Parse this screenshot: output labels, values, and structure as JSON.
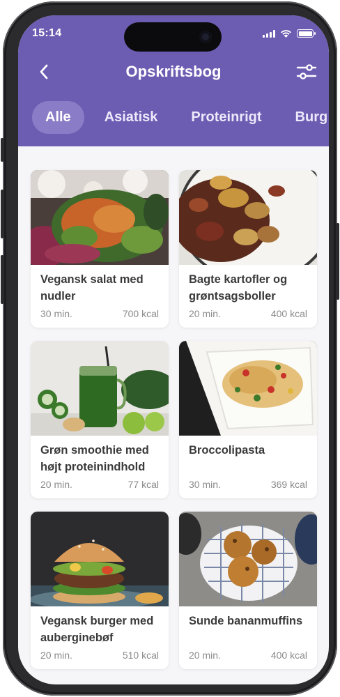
{
  "status_bar": {
    "time": "15:14"
  },
  "header": {
    "title": "Opskriftsbog"
  },
  "tabs": [
    {
      "label": "Alle"
    },
    {
      "label": "Asiatisk"
    },
    {
      "label": "Proteinrigt"
    },
    {
      "label": "Burg"
    }
  ],
  "recipes": [
    {
      "title": "Vegansk salat med nudler",
      "time": "30 min.",
      "kcal": "700 kcal"
    },
    {
      "title": "Bagte kartofler og grøntsagsboller",
      "time": "20 min.",
      "kcal": "400 kcal"
    },
    {
      "title": "Grøn smoothie med højt proteinindhold",
      "time": "20 min.",
      "kcal": "77 kcal"
    },
    {
      "title": "Broccolipasta",
      "time": "30 min.",
      "kcal": "369 kcal"
    },
    {
      "title": "Vegansk burger med auberginebøf",
      "time": "20 min.",
      "kcal": "510 kcal"
    },
    {
      "title": "Sunde bananmuffins",
      "time": "20 min.",
      "kcal": "400 kcal"
    }
  ],
  "colors": {
    "header": "#6d5db2",
    "active_tab": "#8a7cc6"
  }
}
